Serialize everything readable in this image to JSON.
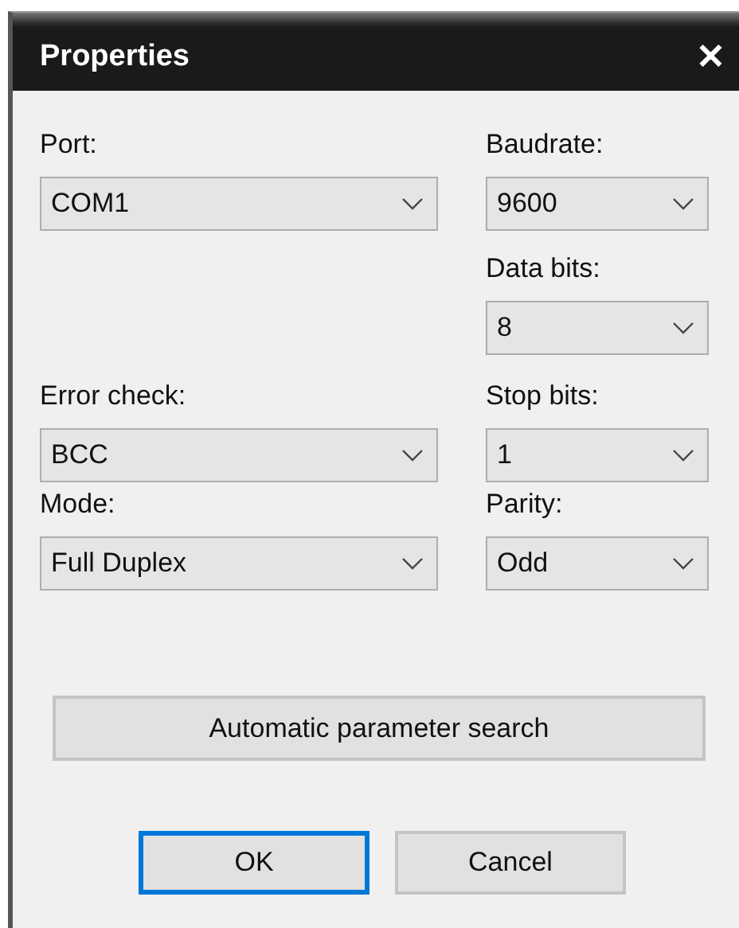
{
  "window": {
    "title": "Properties",
    "close": "✕"
  },
  "rows": [
    {
      "left": {
        "label": "Port:",
        "value": "COM1"
      },
      "right": {
        "label": "Baudrate:",
        "value": "9600"
      }
    },
    {
      "right": {
        "label": "Data bits:",
        "value": "8"
      }
    },
    {
      "left": {
        "label": "Error check:",
        "value": "BCC"
      },
      "right": {
        "label": "Stop bits:",
        "value": "1"
      }
    },
    {
      "left": {
        "label": "Mode:",
        "value": "Full Duplex"
      },
      "right": {
        "label": "Parity:",
        "value": "Odd"
      }
    }
  ],
  "search_button": "Automatic parameter search",
  "buttons": [
    {
      "label": "OK",
      "default": true
    },
    {
      "label": "Cancel",
      "default": false
    }
  ]
}
